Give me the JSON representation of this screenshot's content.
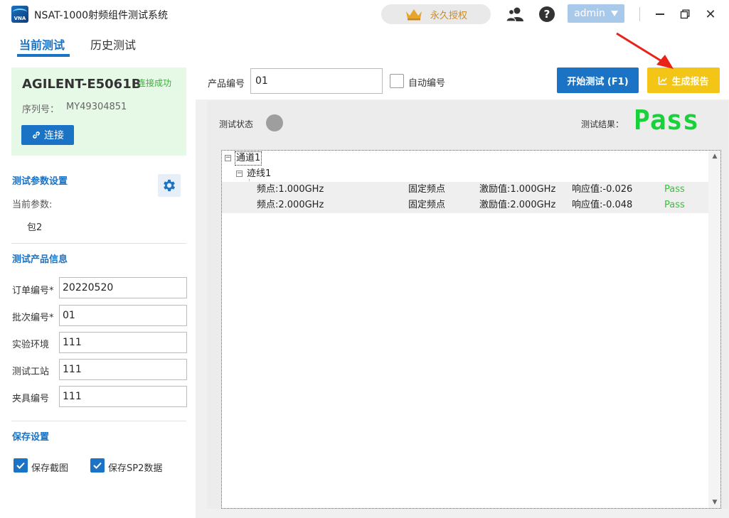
{
  "app": {
    "title": "NSAT-1000射频组件测试系统",
    "logo_text": "VNA"
  },
  "titlebar": {
    "license_label": "永久授权",
    "user": "admin"
  },
  "tabs": [
    {
      "label": "当前测试"
    },
    {
      "label": "历史测试"
    }
  ],
  "device": {
    "name": "AGILENT-E5061B",
    "status": "连接成功",
    "serial_label": "序列号：",
    "serial": "MY49304851",
    "connect_label": "连接"
  },
  "params": {
    "title": "测试参数设置",
    "current_label": "当前参数:",
    "current_value": "包2"
  },
  "product_info": {
    "title": "测试产品信息",
    "fields": [
      {
        "label": "订单编号*",
        "value": "20220520"
      },
      {
        "label": "批次编号*",
        "value": "01"
      },
      {
        "label": "实验环境",
        "value": "111"
      },
      {
        "label": "测试工站",
        "value": "111"
      },
      {
        "label": "夹具编号",
        "value": "111"
      }
    ]
  },
  "save": {
    "title": "保存设置",
    "screenshot_label": "保存截图",
    "sp2_label": "保存SP2数据"
  },
  "toolbar": {
    "product_label": "产品编号",
    "product_value": "01",
    "auto_label": "自动编号",
    "start_label": "开始测试 (F1)",
    "report_label": "生成报告"
  },
  "status": {
    "status_label": "测试状态",
    "result_label": "测试结果：",
    "result_value": "Pass"
  },
  "tree": {
    "channel": "通道1",
    "trace": "迹线1",
    "rows": [
      {
        "freq": "频点:1.000GHz",
        "type": "固定频点",
        "stim": "激励值:1.000GHz",
        "resp": "响应值:-0.026",
        "result": "Pass"
      },
      {
        "freq": "频点:2.000GHz",
        "type": "固定频点",
        "stim": "激励值:2.000GHz",
        "resp": "响应值:-0.048",
        "result": "Pass"
      }
    ]
  },
  "colors": {
    "accent": "#1a73c4",
    "pass": "#19d13a",
    "report": "#f2c516",
    "device_card": "#e6f8e6"
  }
}
